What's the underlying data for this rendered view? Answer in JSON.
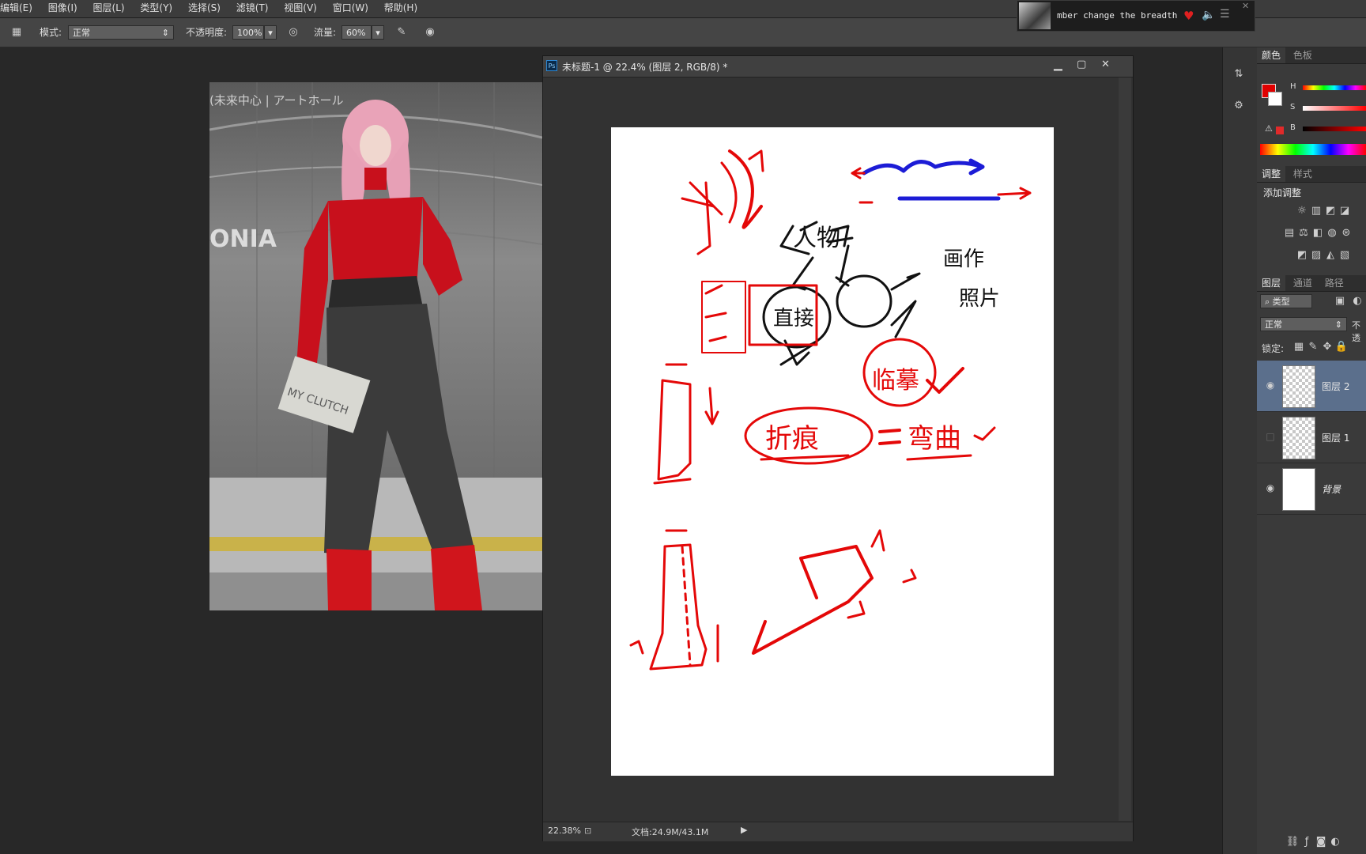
{
  "menu": [
    "编辑(E)",
    "图像(I)",
    "图层(L)",
    "类型(Y)",
    "选择(S)",
    "滤镜(T)",
    "视图(V)",
    "窗口(W)",
    "帮助(H)"
  ],
  "options": {
    "mode_label": "模式:",
    "mode_value": "正常",
    "opacity_label": "不透明度:",
    "opacity_value": "100%",
    "flow_label": "流量:",
    "flow_value": "60%"
  },
  "media": {
    "track": "mber change the breadth"
  },
  "doc": {
    "title": "未标题-1 @ 22.4% (图层 2, RGB/8) *",
    "zoom": "22.38%",
    "size": "文档:24.9M/43.1M"
  },
  "photo": {
    "sign": "ONIA",
    "bag": "MY CLUTCH",
    "jp": "(未来中心 | アートホール"
  },
  "sketch": {
    "w1": "人物",
    "w2": "画作",
    "w3": "照片",
    "w4": "临摹",
    "w5": "折痕",
    "w6": "弯曲",
    "w7": "直接"
  },
  "panels": {
    "color_tabs": [
      "颜色",
      "色板"
    ],
    "hsb": [
      "H",
      "S",
      "B"
    ],
    "adjust_tabs": [
      "调整",
      "样式"
    ],
    "adjust_title": "添加调整",
    "layer_tabs": [
      "图层",
      "通道",
      "路径"
    ],
    "filter_label": "类型",
    "blend_value": "正常",
    "opacity_short": "不透",
    "lock_label": "锁定:",
    "layers": [
      {
        "name": "图层 2",
        "visible": true,
        "selected": true
      },
      {
        "name": "图层 1",
        "visible": false,
        "selected": false
      },
      {
        "name": "背景",
        "visible": true,
        "selected": false
      }
    ]
  },
  "colors": {
    "accent": "#e10000",
    "sketch_red": "#e40808",
    "sketch_blue": "#1c1cd6"
  }
}
